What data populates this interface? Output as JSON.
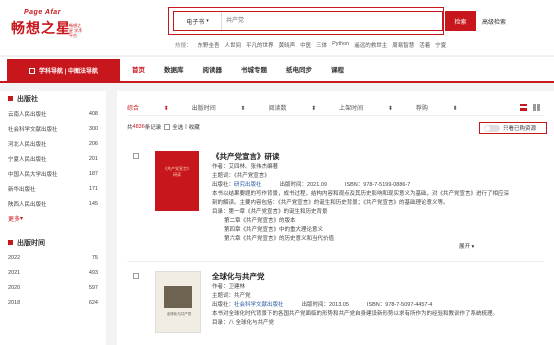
{
  "header": {
    "logo_top": "Page Afar",
    "logo_name": "畅想之星",
    "logo_tag": "畅想之星 学术平台",
    "search_type": "电子书",
    "search_placeholder": "共产党",
    "search_button": "检索",
    "advanced_search": "高级检索",
    "hot_label": "热搜：",
    "hot_words": [
      "东野圭吾",
      "人世间",
      "平凡的世界",
      "黄晓声",
      "中医",
      "三体",
      "Python",
      "遥远的救世主",
      "周易智慧",
      "活着",
      "宁夏"
    ]
  },
  "nav": {
    "red_tab": "学科导航 | 中图法导航",
    "items": [
      "首页",
      "数据库",
      "阅读器",
      "书城专题",
      "纸电同步",
      "课程"
    ]
  },
  "sidebar": {
    "publisher_title": "出版社",
    "publishers": [
      {
        "name": "云南人民出版社",
        "count": "408"
      },
      {
        "name": "社会科学文献出版社",
        "count": "300"
      },
      {
        "name": "河北人民出版社",
        "count": "206"
      },
      {
        "name": "宁夏人民出版社",
        "count": "201"
      },
      {
        "name": "中国人民大学出版社",
        "count": "187"
      },
      {
        "name": "新华出版社",
        "count": "171"
      },
      {
        "name": "陕西人民出版社",
        "count": "145"
      }
    ],
    "more": "更多",
    "year_title": "出版时间",
    "years": [
      {
        "name": "2022",
        "count": "75"
      },
      {
        "name": "2021",
        "count": "493"
      },
      {
        "name": "2020",
        "count": "597"
      },
      {
        "name": "2018",
        "count": "624"
      }
    ]
  },
  "sortbar": {
    "items": [
      "综合",
      "出版时间",
      "阅读数",
      "上架时间",
      "荐购"
    ]
  },
  "results": {
    "count_prefix": "共",
    "count": "4836",
    "count_suffix": "条记录",
    "select_all": "全选",
    "favorite": "收藏",
    "only_purchased": "只看已购资源"
  },
  "books": [
    {
      "title": "《共产党宣言》研读",
      "cover_text": "《共产党宣言》研读",
      "author": "作者：艾四林、张伟杰编著",
      "keywords": "主题词：《共产党宣言》",
      "publisher_label": "出版社：",
      "publisher": "研究出版社",
      "date": "出版时间：2021.09",
      "isbn": "ISBN：978-7-5199-0886-7",
      "summary1": "本书以结果要题的写作背景，成书过程，结构内容和观点及其历史影响和现实意义为基础，对《共产党宣言》进行了相应深",
      "summary2": "刻的解读。主要内容包括：《共产党宣言》的诞生和历史背景；《共产党宣言》的基础理论意义等。",
      "toc1": "目录：第一章《共产党宣言》的诞生和历史背景",
      "toc2": "第二章《共产党宣言》的版本",
      "toc3": "第四章《共产党宣言》中的重大理论意义",
      "toc4": "第六章《共产党宣言》的历史意义和当代价值",
      "expand": "展开"
    },
    {
      "title": "全球化与共产党",
      "cover_text": "全球化与共产党",
      "author": "作者：卫建林",
      "keywords": "主题词：共产党",
      "publisher_label": "出版社：",
      "publisher": "社会科学文献出版社",
      "date": "出版时间：2013.05",
      "isbn": "ISBN：978-7-5097-4457-4",
      "summary1": "本书对全球化时代背景下的各国共产党面临的形势和共产党自身建设新形势以求有所作为的经验和教训作了系统梳理。",
      "toc1": "目录：八 全球化与共产党"
    }
  ]
}
